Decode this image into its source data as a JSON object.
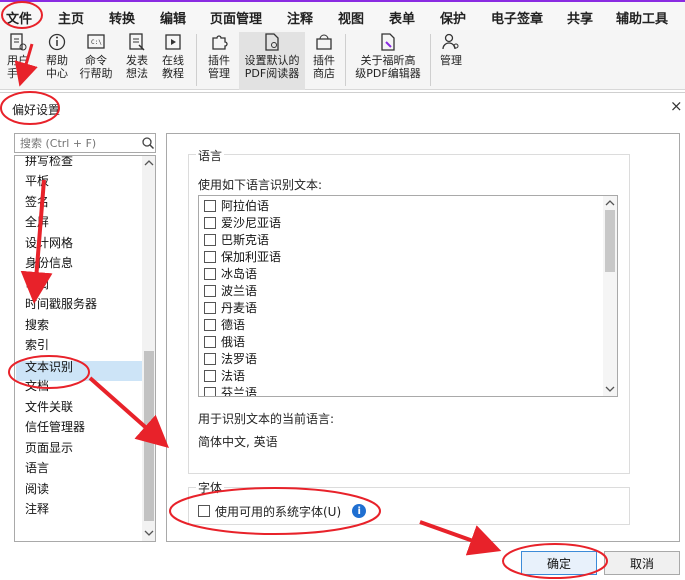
{
  "menubar": {
    "items": [
      "文件",
      "主页",
      "转换",
      "编辑",
      "页面管理",
      "注释",
      "视图",
      "表单",
      "保护",
      "电子签章",
      "共享",
      "辅助工具"
    ]
  },
  "ribbon": {
    "buttons": [
      {
        "line1": "用户",
        "line2": "手册",
        "icon": "user-manual-icon"
      },
      {
        "line1": "帮助",
        "line2": "中心",
        "icon": "help-center-icon"
      },
      {
        "line1": "命令",
        "line2": "行帮助",
        "icon": "command-line-icon"
      },
      {
        "line1": "发表",
        "line2": "想法",
        "icon": "feedback-icon"
      },
      {
        "line1": "在线",
        "line2": "教程",
        "icon": "online-tutorial-icon"
      },
      {
        "line1": "插件",
        "line2": "管理",
        "icon": "plugin-manage-icon"
      },
      {
        "line1": "设置默认的",
        "line2": "PDF阅读器",
        "icon": "default-reader-icon"
      },
      {
        "line1": "插件",
        "line2": "商店",
        "icon": "plugin-store-icon"
      },
      {
        "line1": "关于福昕高",
        "line2": "级PDF编辑器",
        "icon": "about-icon"
      },
      {
        "line1": "管理",
        "line2": "",
        "icon": "manage-icon"
      }
    ]
  },
  "dialog": {
    "title": "偏好设置",
    "close_glyph": "×",
    "search_placeholder": "搜索 (Ctrl + F)",
    "categories": [
      "拼写检查",
      "平板",
      "签名",
      "全屏",
      "设计网格",
      "身份信息",
      "审阅",
      "时间戳服务器",
      "搜索",
      "索引",
      "文本识别",
      "文档",
      "文件关联",
      "信任管理器",
      "页面显示",
      "语言",
      "阅读",
      "注释"
    ],
    "selected_category": "文本识别",
    "language_group": {
      "title": "语言",
      "prompt": "使用如下语言识别文本:",
      "languages": [
        "阿拉伯语",
        "爱沙尼亚语",
        "巴斯克语",
        "保加利亚语",
        "冰岛语",
        "波兰语",
        "丹麦语",
        "德语",
        "俄语",
        "法罗语",
        "法语",
        "芬兰语"
      ],
      "current_label": "用于识别文本的当前语言:",
      "current_value": "简体中文, 英语"
    },
    "font_group": {
      "title": "字体",
      "checkbox_label": "使用可用的系统字体(U)",
      "info_glyph": "i"
    },
    "ok_label": "确定",
    "cancel_label": "取消"
  },
  "colors": {
    "annotation_red": "#e8222a",
    "selection": "#cde4f7",
    "menubar_accent": "#8a2be2",
    "info_blue": "#1f6fd1"
  }
}
